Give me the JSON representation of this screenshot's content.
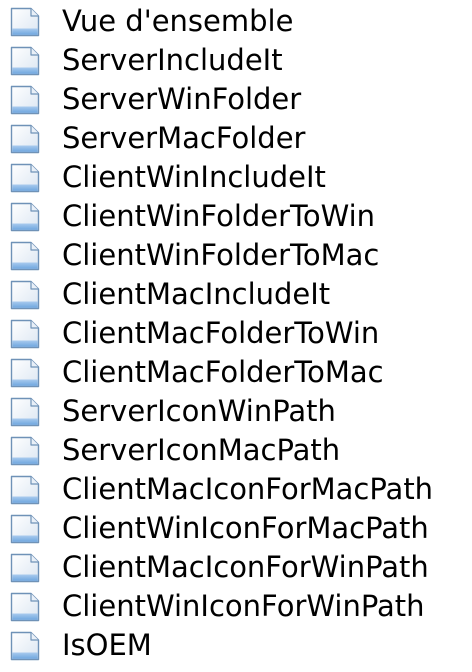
{
  "topics": {
    "icon": "document-page-icon",
    "items": [
      {
        "label": "Vue d'ensemble"
      },
      {
        "label": "ServerIncludeIt"
      },
      {
        "label": "ServerWinFolder"
      },
      {
        "label": "ServerMacFolder"
      },
      {
        "label": "ClientWinIncludeIt"
      },
      {
        "label": "ClientWinFolderToWin"
      },
      {
        "label": "ClientWinFolderToMac"
      },
      {
        "label": "ClientMacIncludeIt"
      },
      {
        "label": "ClientMacFolderToWin"
      },
      {
        "label": "ClientMacFolderToMac"
      },
      {
        "label": "ServerIconWinPath"
      },
      {
        "label": "ServerIconMacPath"
      },
      {
        "label": "ClientMacIconForMacPath"
      },
      {
        "label": "ClientWinIconForMacPath"
      },
      {
        "label": "ClientMacIconForWinPath"
      },
      {
        "label": "ClientWinIconForWinPath"
      },
      {
        "label": "IsOEM"
      }
    ]
  }
}
